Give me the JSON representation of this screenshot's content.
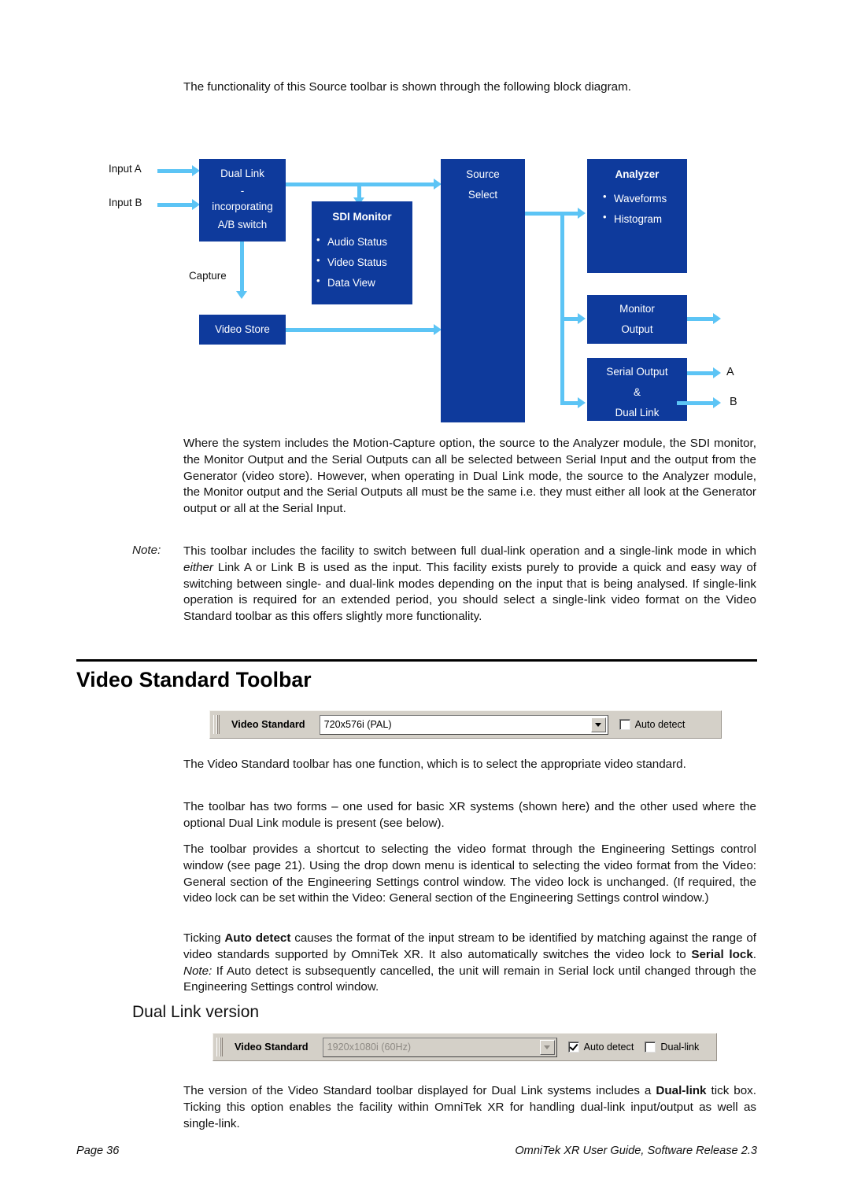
{
  "intro_paragraph": "The functionality of this Source toolbar is shown through the following block diagram.",
  "diagram": {
    "input_a_label": "Input A",
    "input_b_label": "Input B",
    "capture_label": "Capture",
    "dual_link_box": {
      "line1": "Dual Link",
      "line2": "-",
      "line3": "incorporating",
      "line4": "A/B switch"
    },
    "video_store_box": {
      "line1": "Video Store"
    },
    "sdi_monitor_box": {
      "title": "SDI Monitor",
      "items": [
        "Audio Status",
        "Video Status",
        "Data View"
      ]
    },
    "source_select_box": {
      "line1": "Source",
      "line2": "Select"
    },
    "analyzer_box": {
      "title": "Analyzer",
      "items": [
        "Waveforms",
        "Histogram"
      ]
    },
    "monitor_output_box": {
      "line1": "Monitor",
      "line2": "Output"
    },
    "serial_output_box": {
      "line1": "Serial Output",
      "line2": "&",
      "line3": "Dual Link"
    },
    "output_a_label": "A",
    "output_b_label": "B",
    "colors": {
      "box_fill": "#0E3A9C",
      "arrow": "#5CC4F5",
      "box_text": "#FFFFFF"
    }
  },
  "body": {
    "para_where": "Where the system includes the Motion-Capture option, the source to the Analyzer module, the SDI monitor, the Monitor Output and the Serial Outputs can all be selected between Serial Input and the output from the Generator (video store). However, when operating in Dual Link mode, the source to the Analyzer module, the Monitor output and the Serial Outputs all must be the same i.e. they must either all look at the Generator output or all at the Serial Input.",
    "note_label": "Note:",
    "note_part1": "This toolbar includes the facility to switch between full dual-link operation and a single-link mode in which ",
    "note_emph": "either",
    "note_part2": " Link A or Link B is used as the input. This facility exists purely to provide a quick and easy way of switching between single- and dual-link modes depending on the input that is being analysed. If single-link operation is required for an extended period, you should select a single-link video format on the Video Standard toolbar as this offers slightly more functionality.",
    "para_one_function": "The Video Standard toolbar has one function, which is to select the appropriate video standard.",
    "para_two_forms": "The toolbar has two forms – one used for basic XR systems (shown here) and the other used where the optional Dual Link module is present (see below).",
    "para_shortcut": "The toolbar provides a shortcut to selecting the video format through the Engineering Settings control window (see page 21). Using the drop down menu is identical to selecting the video format from the Video: General section of the Engineering Settings control window. The video lock is unchanged. (If required, the video lock can be set within the Video: General section of the Engineering Settings control window.)",
    "para_ticking_1": "Ticking ",
    "para_ticking_b1": "Auto detect",
    "para_ticking_2": " causes the format of the input stream to be identified by matching against the range of video standards supported by OmniTek XR. It also automatically switches the video lock to ",
    "para_ticking_b2": "Serial lock",
    "para_ticking_3": ". ",
    "para_ticking_note": "Note:",
    "para_ticking_4": " If Auto detect is subsequently cancelled, the unit will remain in Serial lock until changed through the Engineering Settings control window.",
    "para_dual_1": "The version of the Video Standard toolbar displayed for Dual Link systems includes a ",
    "para_dual_b": "Dual-link",
    "para_dual_2": " tick box. Ticking this option enables the facility within OmniTek XR for handling dual-link input/output as well as single-link."
  },
  "headings": {
    "video_standard_toolbar": "Video Standard Toolbar",
    "dual_link_version": "Dual Link version"
  },
  "toolbar_basic": {
    "button_label": "Video Standard",
    "combo_value": "720x576i (PAL)",
    "auto_detect_label": "Auto detect",
    "auto_detect_checked": false
  },
  "toolbar_dual": {
    "button_label": "Video Standard",
    "combo_value": "1920x1080i (60Hz)",
    "combo_disabled": true,
    "auto_detect_label": "Auto detect",
    "auto_detect_checked": true,
    "dual_link_label": "Dual-link",
    "dual_link_checked": false
  },
  "footer": {
    "page": "Page 36",
    "guide": "OmniTek XR User Guide, Software Release 2.3"
  }
}
